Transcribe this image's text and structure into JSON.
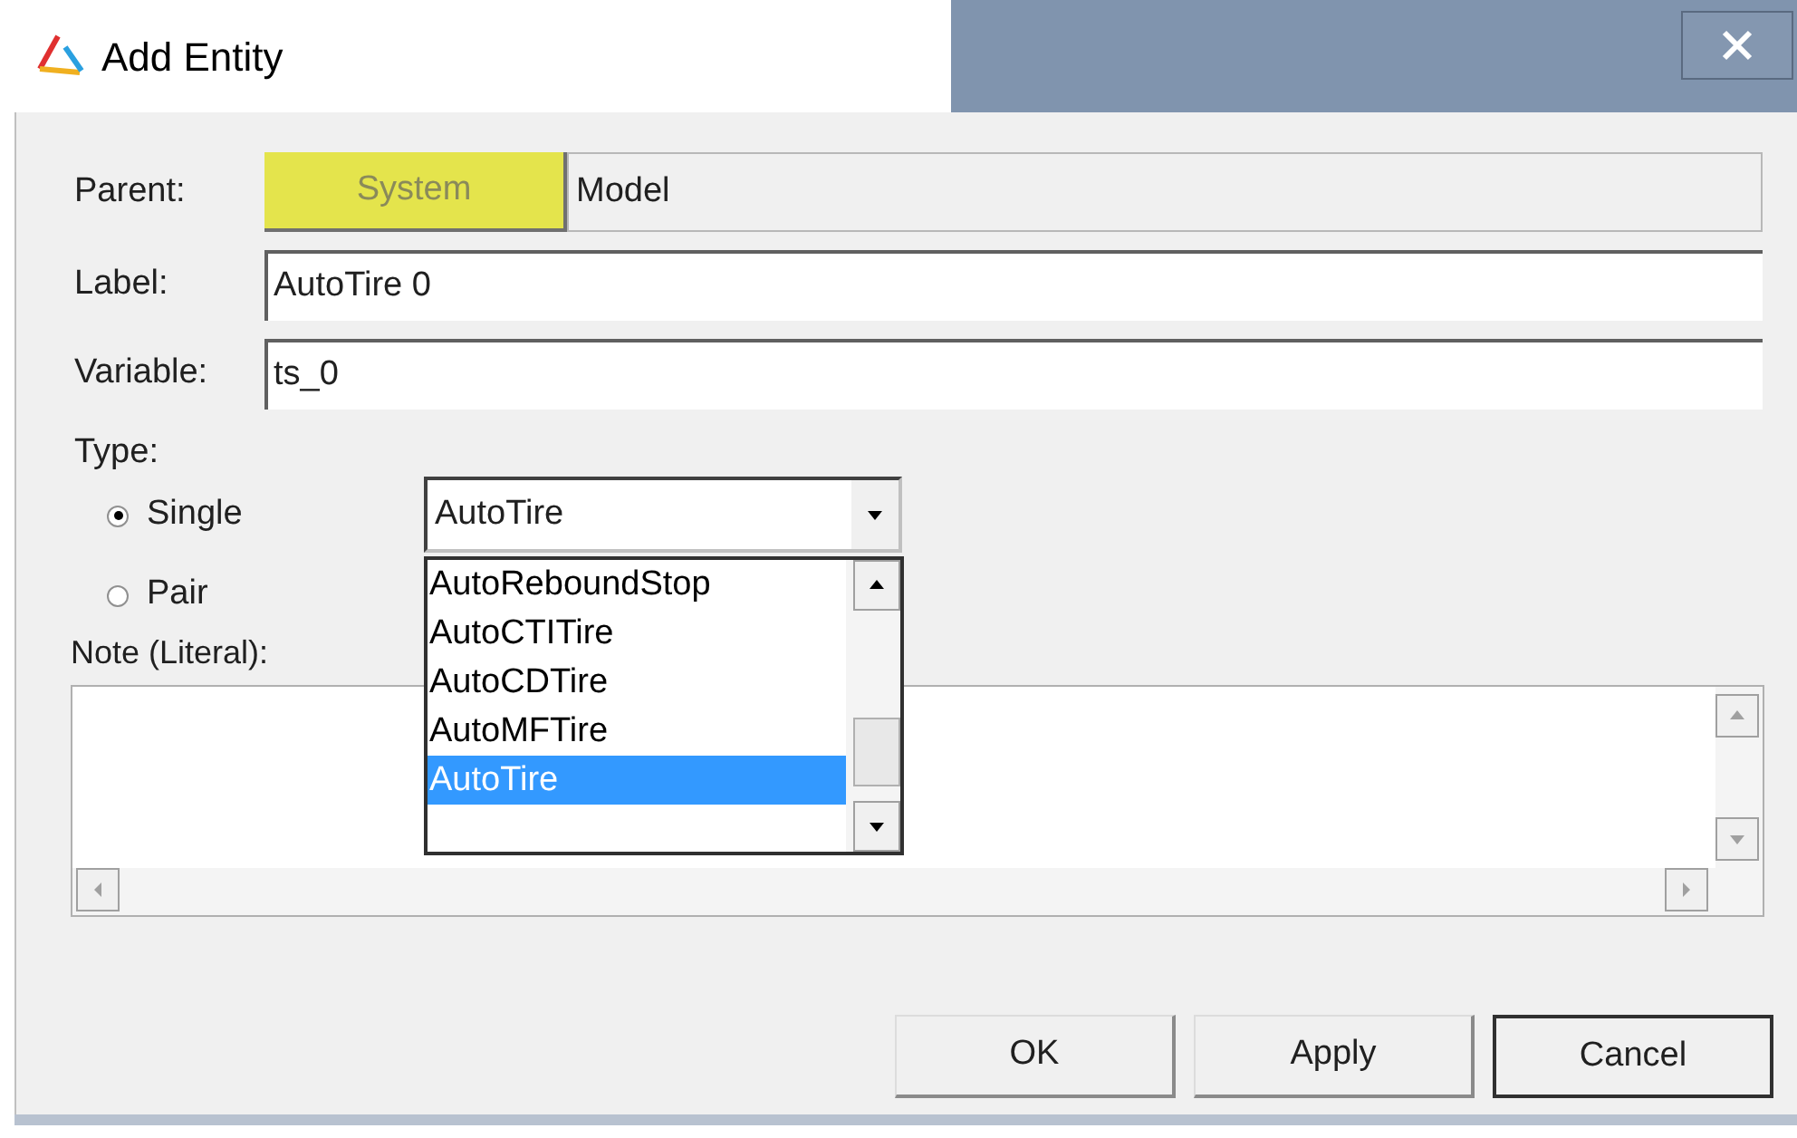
{
  "window": {
    "title": "Add Entity"
  },
  "parent": {
    "label": "Parent:",
    "button": "System",
    "value": "Model"
  },
  "fields": [
    {
      "label": "Label:",
      "value": "AutoTire 0"
    },
    {
      "label": "Variable:",
      "value": "ts_0"
    }
  ],
  "type": {
    "label": "Type:",
    "options": [
      {
        "label": "Single",
        "selected": true
      },
      {
        "label": "Pair",
        "selected": false
      }
    ],
    "combo": {
      "value": "AutoTire",
      "expanded": true,
      "items": [
        {
          "label": "AutoReboundStop",
          "selected": false
        },
        {
          "label": "AutoCTITire",
          "selected": false
        },
        {
          "label": "AutoCDTire",
          "selected": false
        },
        {
          "label": "AutoMFTire",
          "selected": false
        },
        {
          "label": "AutoTire",
          "selected": true
        }
      ]
    }
  },
  "note": {
    "label": "Note (Literal):"
  },
  "buttons": [
    {
      "label": "OK",
      "default": false
    },
    {
      "label": "Apply",
      "default": false
    },
    {
      "label": "Cancel",
      "default": true
    }
  ]
}
